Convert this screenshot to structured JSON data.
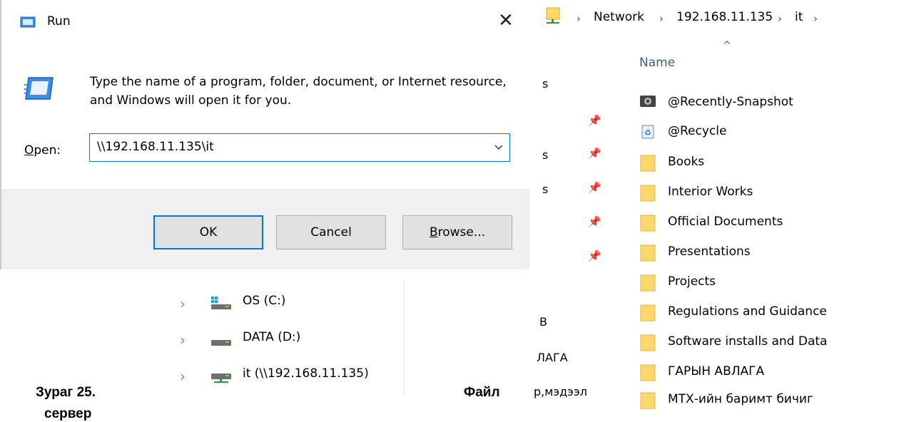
{
  "run_dialog": {
    "title": "Run",
    "close_glyph": "✕",
    "description": "Type the name of a program, folder, document, or Internet resource, and Windows will open it for you.",
    "open_label": "Open:",
    "open_value": "\\\\192.168.11.135\\it",
    "ok_label": "OK",
    "cancel_label": "Cancel",
    "browse_label": "Browse..."
  },
  "nav_pane": {
    "items": [
      {
        "label": "OS (C:)",
        "icon": "os-drive-icon"
      },
      {
        "label": "DATA (D:)",
        "icon": "drive-icon"
      },
      {
        "label": "it (\\\\192.168.11.135)",
        "icon": "network-drive-icon"
      }
    ]
  },
  "caption": {
    "left": "Зураг 25.",
    "right": "Файл",
    "second_line": "сервер"
  },
  "breadcrumb": {
    "items": [
      "Network",
      "192.168.11.135",
      "it"
    ]
  },
  "file_list": {
    "column_header": "Name",
    "items": [
      {
        "name": "@Recently-Snapshot",
        "icon": "snapshot-folder-icon"
      },
      {
        "name": "@Recycle",
        "icon": "recycle-bin-icon"
      },
      {
        "name": "Books",
        "icon": "folder-icon"
      },
      {
        "name": "Interior Works",
        "icon": "folder-icon"
      },
      {
        "name": "Official Documents",
        "icon": "folder-icon"
      },
      {
        "name": "Presentations",
        "icon": "folder-icon"
      },
      {
        "name": "Projects",
        "icon": "folder-icon"
      },
      {
        "name": "Regulations and Guidance",
        "icon": "folder-icon"
      },
      {
        "name": "Software installs and Data",
        "icon": "folder-icon"
      },
      {
        "name": "ГАРЫН АВЛАГА",
        "icon": "folder-icon"
      },
      {
        "name": "МТХ-ийн баримт бичиг",
        "icon": "folder-icon"
      }
    ]
  },
  "truncated_left_column": {
    "items": [
      "s",
      "s",
      "s",
      "В",
      "ЛАГА",
      "р,мэдээл"
    ]
  },
  "colors": {
    "accent": "#0078d7",
    "folder": "#ffd86b",
    "dialog_bg": "#f0f0f0"
  }
}
